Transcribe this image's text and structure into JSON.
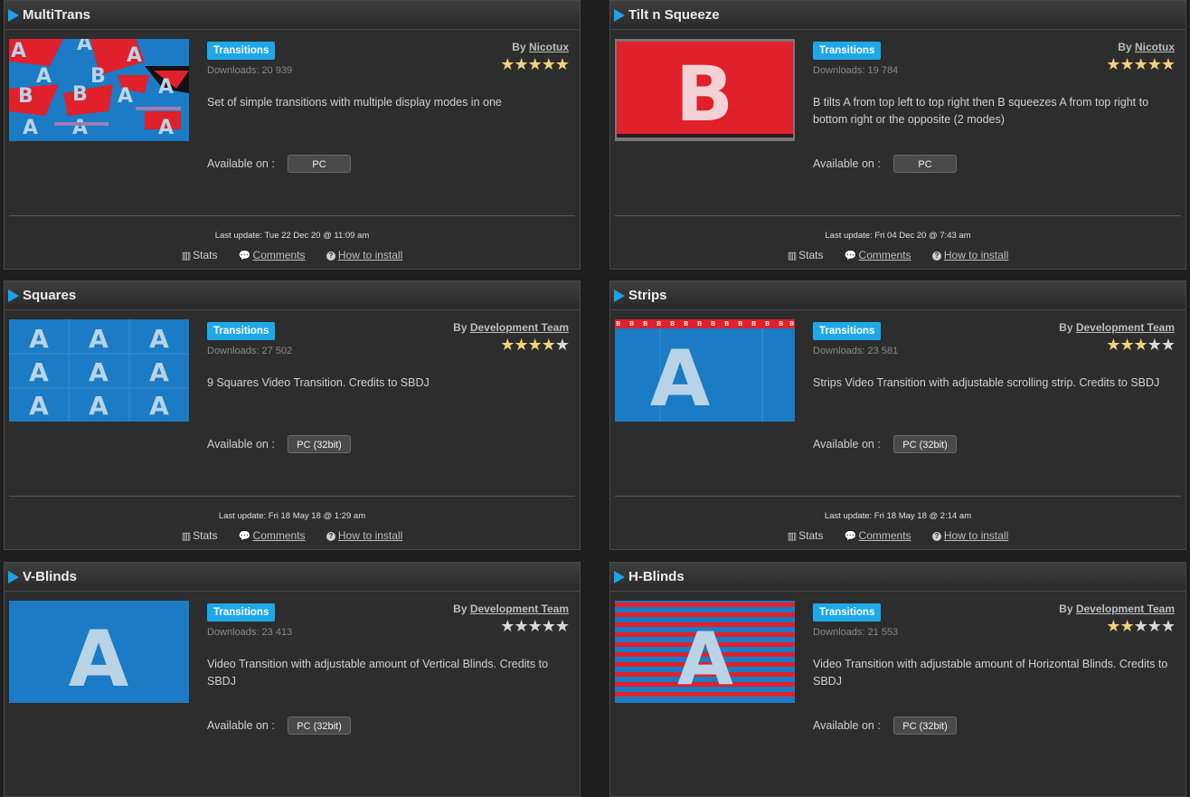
{
  "labels": {
    "by": "By",
    "available_on": "Available on :",
    "stats": "Stats",
    "comments": "Comments",
    "how_to_install": "How to install"
  },
  "colors": {
    "accent": "#1ea8e8",
    "star_on": "#f2d27a",
    "star_off": "#d9d9d9"
  },
  "icons": {
    "stats": "bar-chart-icon",
    "comments": "speech-bubble-icon",
    "install": "question-circle-icon"
  },
  "plugins": [
    {
      "title": "MultiTrans",
      "category": "Transitions",
      "downloads": "Downloads: 20 939",
      "author": "Nicotux",
      "rating": 5,
      "description": "Set of simple transitions with multiple display modes in one",
      "platform": "PC",
      "last_update": "Last update: Tue 22 Dec 20 @ 11:09 am"
    },
    {
      "title": "Tilt n Squeeze",
      "category": "Transitions",
      "downloads": "Downloads: 19 784",
      "author": "Nicotux",
      "rating": 5,
      "description": "B tilts A from top left to top right then B squeezes A from top right to bottom right or the opposite (2 modes)",
      "platform": "PC",
      "last_update": "Last update: Fri 04 Dec 20 @ 7:43 am"
    },
    {
      "title": "Squares",
      "category": "Transitions",
      "downloads": "Downloads: 27 502",
      "author": "Development Team",
      "rating": 4,
      "description": "9 Squares Video Transition. Credits to SBDJ",
      "platform": "PC (32bit)",
      "last_update": "Last update: Fri 18 May 18 @ 1:29 am"
    },
    {
      "title": "Strips",
      "category": "Transitions",
      "downloads": "Downloads: 23 581",
      "author": "Development Team",
      "rating": 3,
      "description": "Strips Video Transition with adjustable scrolling strip. Credits to SBDJ",
      "platform": "PC (32bit)",
      "last_update": "Last update: Fri 18 May 18 @ 2:14 am"
    },
    {
      "title": "V-Blinds",
      "category": "Transitions",
      "downloads": "Downloads: 23 413",
      "author": "Development Team",
      "rating": 0,
      "description": "Video Transition with adjustable amount of Vertical Blinds. Credits to SBDJ",
      "platform": "PC (32bit)"
    },
    {
      "title": "H-Blinds",
      "category": "Transitions",
      "downloads": "Downloads: 21 553",
      "author": "Development Team",
      "rating": 2,
      "description": "Video Transition with adjustable amount of Horizontal Blinds. Credits to SBDJ",
      "platform": "PC (32bit)"
    }
  ]
}
